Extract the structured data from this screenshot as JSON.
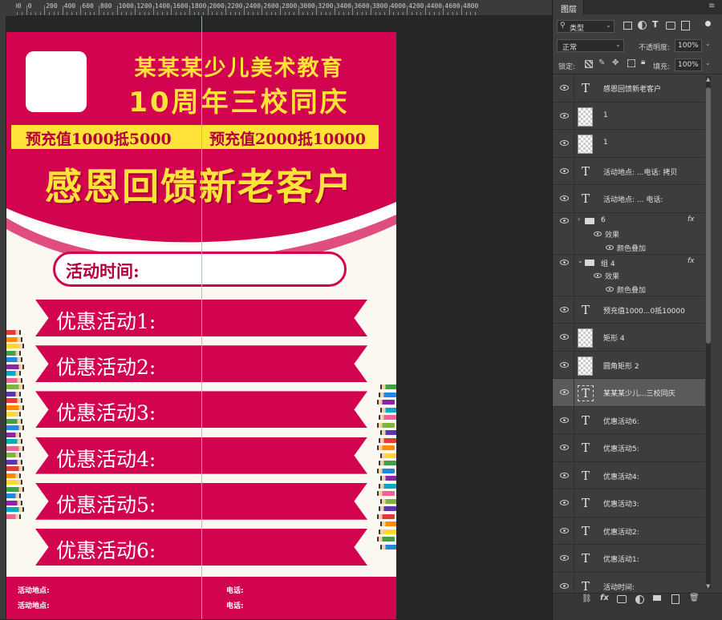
{
  "ruler": {
    "labels": [
      "200",
      "0",
      "200",
      "400",
      "600",
      "800",
      "1000",
      "1200",
      "1400",
      "1600",
      "1800",
      "2000",
      "2200",
      "2400",
      "2600",
      "2800",
      "3000",
      "3200",
      "3400",
      "3600",
      "3800",
      "4000",
      "4200",
      "4400",
      "4600",
      "4800"
    ]
  },
  "poster": {
    "org": "某某某少儿美术教育",
    "anniversary": "10周年三校同庆",
    "offer1": "预充值1000抵5000",
    "offer2": "预充值2000抵10000",
    "headline": "感恩回馈新老客户",
    "time_label": "活动时间:",
    "activities": [
      "优惠活动1:",
      "优惠活动2:",
      "优惠活动3:",
      "优惠活动4:",
      "优惠活动5:",
      "优惠活动6:"
    ],
    "footer": {
      "address1": "活动地点:",
      "phone1": "电话:",
      "address2": "活动地点:",
      "phone2": "电话:"
    }
  },
  "panel": {
    "title": "图层",
    "filter": "类型",
    "blend_mode": "正常",
    "opacity_label": "不透明度:",
    "opacity_value": "100%",
    "lock_label": "锁定:",
    "fill_label": "填充:",
    "fill_value": "100%",
    "layers": [
      {
        "type": "text",
        "name": "感恩回馈新老客户"
      },
      {
        "type": "image",
        "name": "1"
      },
      {
        "type": "image",
        "name": "1"
      },
      {
        "type": "text",
        "name": "活动地点: ...电话: 拷贝"
      },
      {
        "type": "text",
        "name": "活动地点:   ...   电话:"
      },
      {
        "type": "group",
        "name": "6",
        "effects": "效果",
        "effect": "颜色叠加"
      },
      {
        "type": "group",
        "name": "组 4",
        "effects": "效果",
        "effect": "颜色叠加"
      },
      {
        "type": "text",
        "name": "预充值1000...0抵10000"
      },
      {
        "type": "shape",
        "name": "矩形 4"
      },
      {
        "type": "shape",
        "name": "圆角矩形 2"
      },
      {
        "type": "text",
        "name": "某某某少儿...三校同庆",
        "selected": true
      },
      {
        "type": "text",
        "name": "优惠活动6:"
      },
      {
        "type": "text",
        "name": "优惠活动5:"
      },
      {
        "type": "text",
        "name": "优惠活动4:"
      },
      {
        "type": "text",
        "name": "优惠活动3:"
      },
      {
        "type": "text",
        "name": "优惠活动2:"
      },
      {
        "type": "text",
        "name": "优惠活动1:"
      },
      {
        "type": "text",
        "name": "活动时间:"
      }
    ],
    "fx_label": "fx",
    "colors": {
      "primary": "#d3044f",
      "yellow": "#ffe338",
      "panel_bg": "#3d3d3d",
      "selected": "#5a5a5a"
    }
  }
}
